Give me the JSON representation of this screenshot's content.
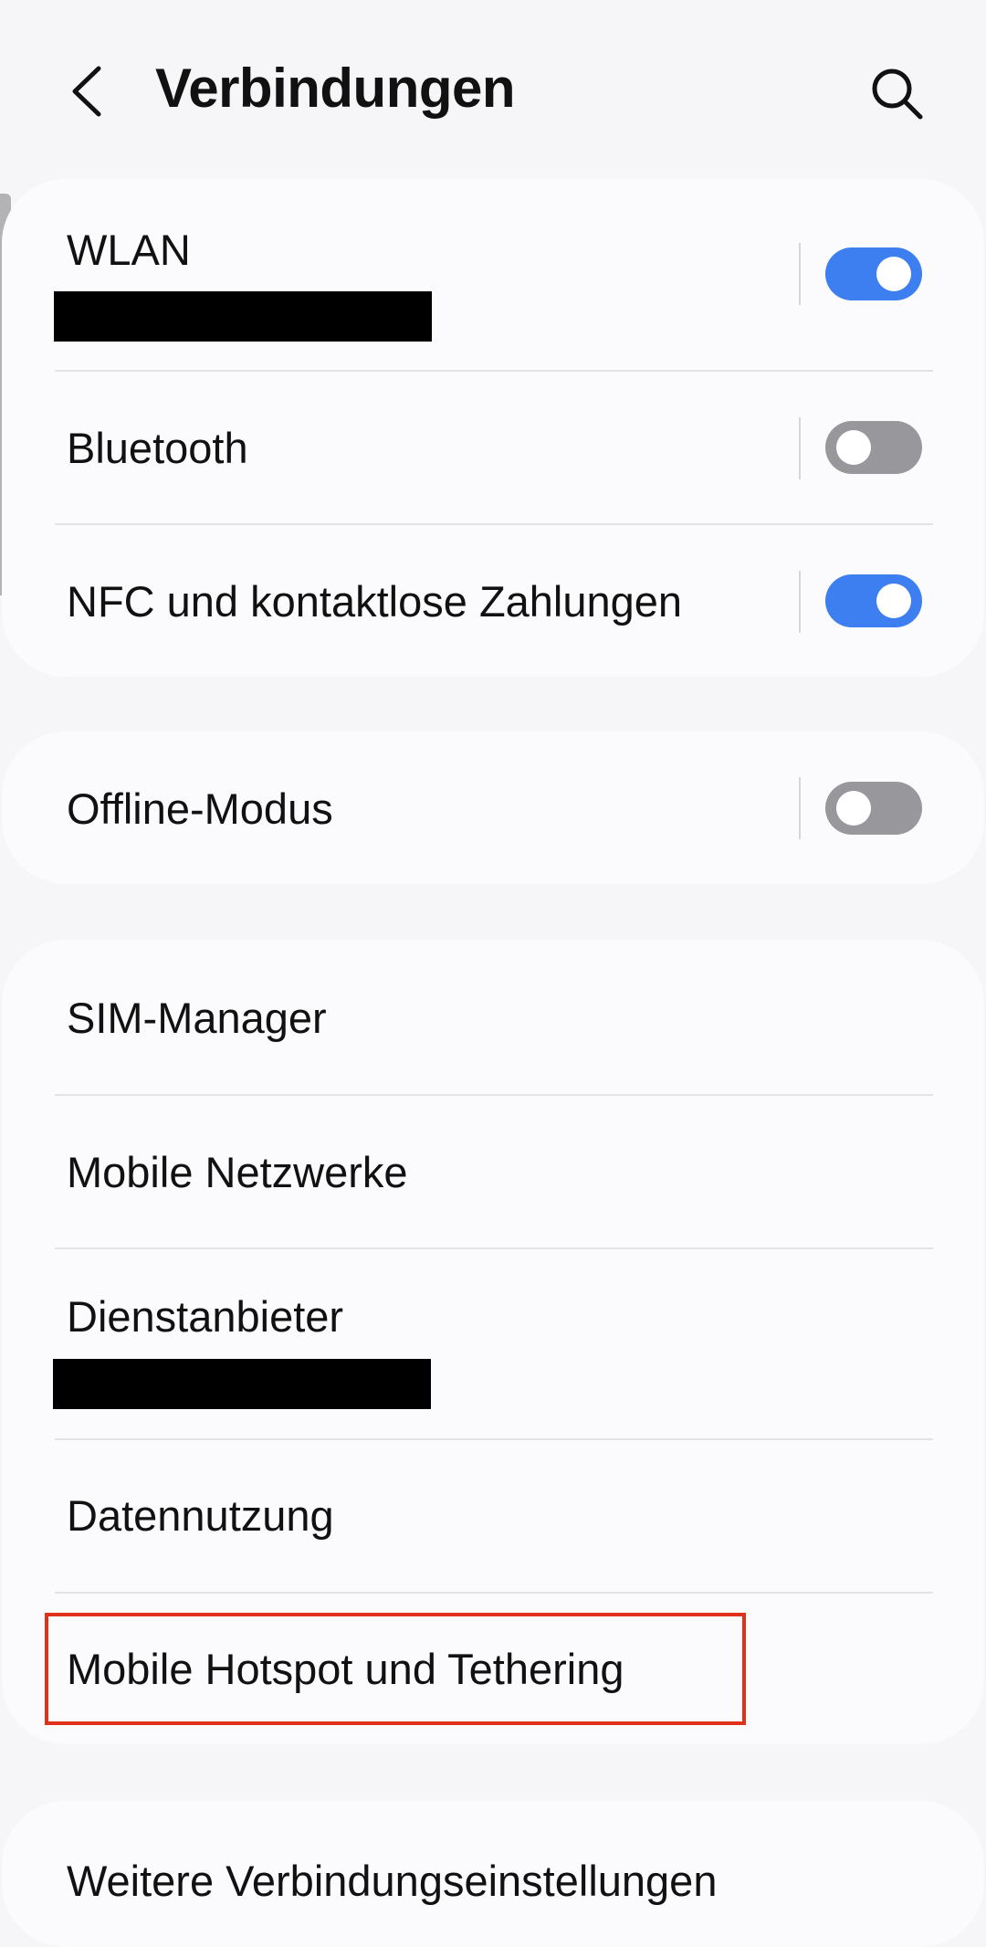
{
  "header": {
    "title": "Verbindungen",
    "back_icon": "chevron-left-icon",
    "search_icon": "search-icon"
  },
  "colors": {
    "toggle_on": "#3d7ef0",
    "toggle_off": "#98989c",
    "highlight": "#e0321b"
  },
  "group1": {
    "wlan": {
      "label": "WLAN",
      "toggle": "on"
    },
    "bluetooth": {
      "label": "Bluetooth",
      "toggle": "off"
    },
    "nfc": {
      "label": "NFC und kontaktlose Zahlungen",
      "toggle": "on"
    }
  },
  "group2": {
    "offline": {
      "label": "Offline-Modus",
      "toggle": "off"
    }
  },
  "group3": {
    "sim_manager": {
      "label": "SIM-Manager"
    },
    "mobile_networks": {
      "label": "Mobile Netzwerke"
    },
    "provider": {
      "label": "Dienstanbieter"
    },
    "data_usage": {
      "label": "Datennutzung"
    },
    "hotspot": {
      "label": "Mobile Hotspot und Tethering"
    }
  },
  "group4": {
    "more": {
      "label": "Weitere Verbindungseinstellungen"
    }
  }
}
